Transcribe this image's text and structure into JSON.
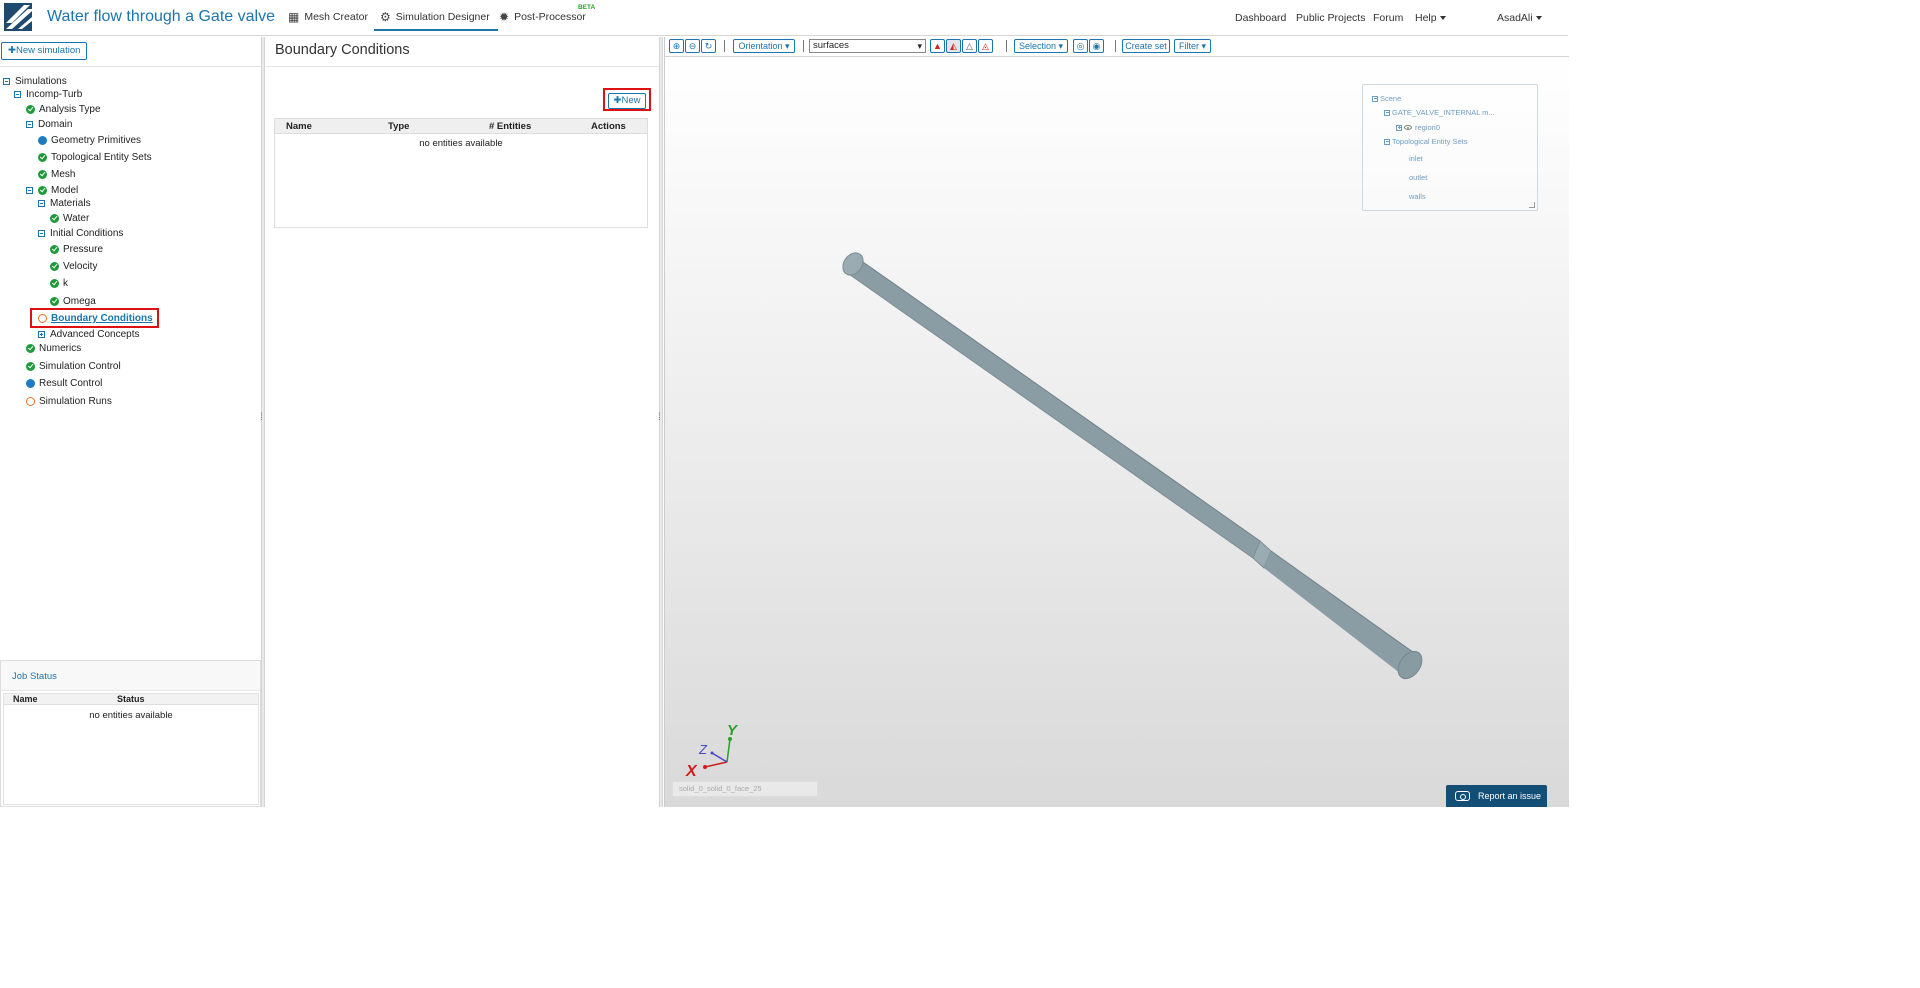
{
  "app": {
    "title": "Water flow through a Gate valve"
  },
  "nav": {
    "tabs": [
      {
        "label": "Mesh Creator",
        "icon": "grid-icon"
      },
      {
        "label": "Simulation Designer",
        "icon": "gears-icon"
      },
      {
        "label": "Post-Processor",
        "icon": "sun-gear-icon",
        "badge": "BETA"
      }
    ],
    "right": {
      "dashboard": "Dashboard",
      "public_projects": "Public Projects",
      "forum": "Forum",
      "help": "Help",
      "user": "AsadAli"
    }
  },
  "sidebar": {
    "new_simulation": "New simulation",
    "tree": {
      "simulations": "Simulations",
      "incomp_turb": "Incomp-Turb",
      "analysis_type": "Analysis Type",
      "domain": "Domain",
      "geometry_primitives": "Geometry Primitives",
      "topological_entity_sets": "Topological Entity Sets",
      "mesh": "Mesh",
      "model": "Model",
      "materials": "Materials",
      "water": "Water",
      "initial_conditions": "Initial Conditions",
      "pressure": "Pressure",
      "velocity": "Velocity",
      "k": "k",
      "omega": "Omega",
      "boundary_conditions": "Boundary Conditions",
      "advanced_concepts": "Advanced Concepts",
      "numerics": "Numerics",
      "simulation_control": "Simulation Control",
      "result_control": "Result Control",
      "simulation_runs": "Simulation Runs"
    },
    "job_status": {
      "title": "Job Status",
      "columns": [
        "Name",
        "Status"
      ],
      "empty": "no entities available"
    }
  },
  "main": {
    "title": "Boundary Conditions",
    "new_button": "New",
    "table": {
      "columns": [
        "Name",
        "Type",
        "# Entities",
        "Actions"
      ],
      "empty": "no entities available"
    }
  },
  "viewer": {
    "toolbar": {
      "orientation": "Orientation",
      "render_mode": "surfaces",
      "selection": "Selection",
      "create_set": "Create set",
      "filter": "Filter"
    },
    "scene": {
      "root": "Scene",
      "model": "GATE_VALVE_INTERNAL m...",
      "region": "region0",
      "sets_group": "Topological Entity Sets",
      "sets": [
        "inlet",
        "outlet",
        "walls"
      ]
    },
    "axes": {
      "x": "X",
      "y": "Y",
      "z": "Z"
    },
    "face_status": "solid_0_solid_0_face_25",
    "report": "Report an issue",
    "colors": {
      "pipe": "#8a9ca3",
      "axis_x": "#d01c1c",
      "axis_y": "#2aa02a",
      "axis_z": "#4848c8"
    }
  }
}
